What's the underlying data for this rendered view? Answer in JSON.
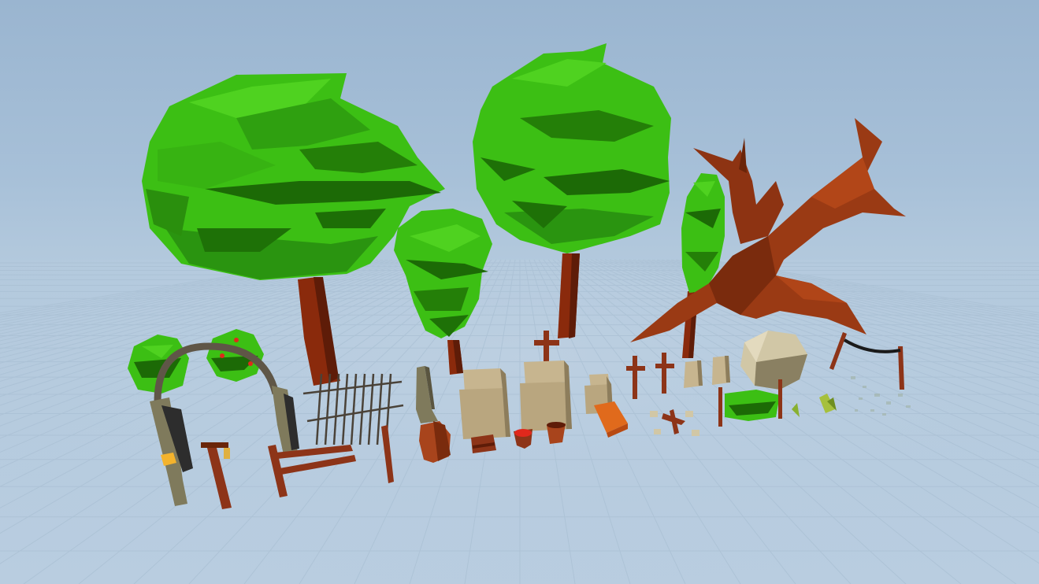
{
  "scene": {
    "type": "low-poly asset preview",
    "colors": {
      "sky_top": "#9ab5d0",
      "sky_bottom": "#b9cde0",
      "grid_line": "#a9bfd3",
      "leaf_light": "#45c81a",
      "leaf_mid": "#2fa010",
      "leaf_dark": "#1c6a06",
      "trunk": "#8a2a0c",
      "trunk_dark": "#5e1c08",
      "dead_tree": "#9a3a14",
      "stone": "#c7b58f",
      "stone_dark": "#8d7d5c",
      "gate_stone": "#7f7a5c",
      "wood": "#8d3418",
      "iron": "#5f5647",
      "rock": "#d1c7a6",
      "lamp_glow": "#f4b32c",
      "fire": "#e0281c",
      "orange_mat": "#e06a1c"
    },
    "assets": [
      "large-tree",
      "bushy-tree",
      "tall-tree",
      "slim-tree",
      "dead-tree",
      "graveyard-gate",
      "lantern-post",
      "broken-fence",
      "iron-fence",
      "fence-post",
      "obelisk",
      "clay-pot",
      "stone-tomb",
      "cross-tomb",
      "small-tomb",
      "small-chest",
      "fire-bowl",
      "bucket",
      "orange-crate",
      "wooden-cross",
      "grave-slab",
      "boulder",
      "debris-pile",
      "hedge",
      "grass-tuft",
      "clothesline",
      "scattered-rubble"
    ]
  }
}
